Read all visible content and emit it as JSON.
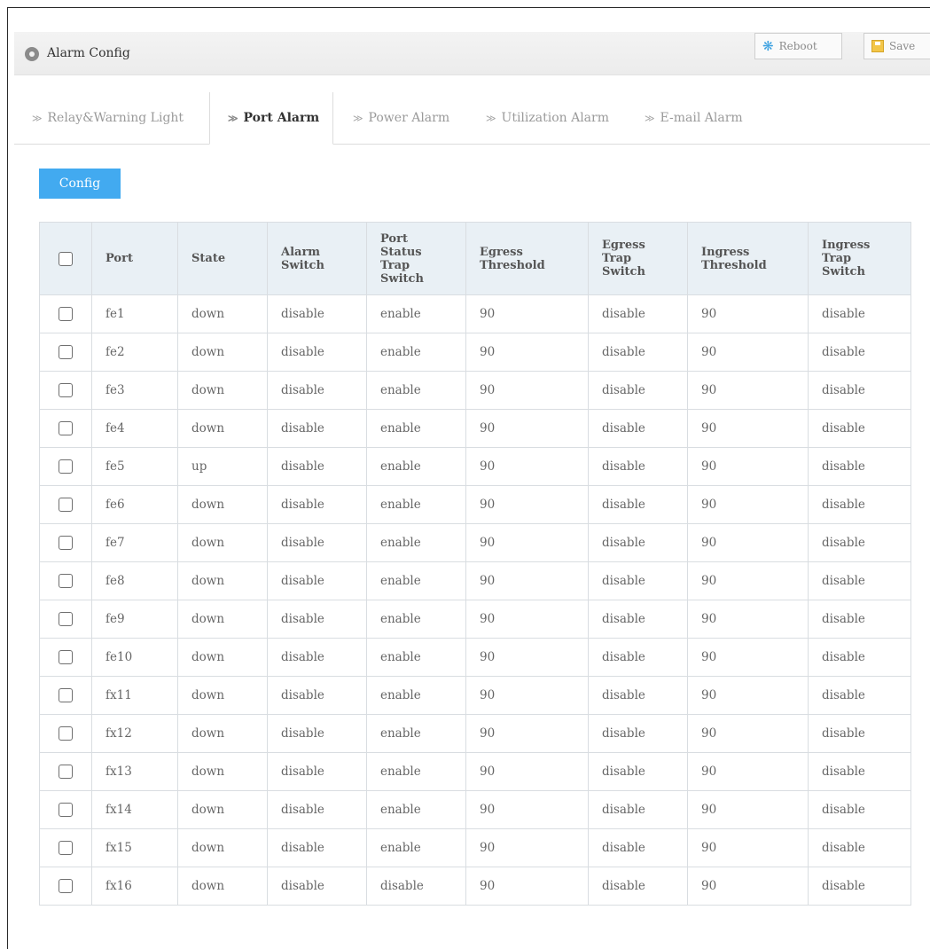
{
  "window": {
    "title": "Alarm Config",
    "reboot_label": "Reboot",
    "save_label": "Save"
  },
  "tabs": [
    {
      "label": "Relay&Warning Light",
      "active": false
    },
    {
      "label": "Port Alarm",
      "active": true
    },
    {
      "label": "Power Alarm",
      "active": false
    },
    {
      "label": "Utilization Alarm",
      "active": false
    },
    {
      "label": "E-mail Alarm",
      "active": false
    }
  ],
  "config_button": "Config",
  "table": {
    "headers": [
      "Port",
      "State",
      "Alarm Switch",
      "Port Status Trap Switch",
      "Egress Threshold",
      "Egress Trap Switch",
      "Ingress Threshold",
      "Ingress Trap Switch"
    ],
    "rows": [
      [
        "fe1",
        "down",
        "disable",
        "enable",
        "90",
        "disable",
        "90",
        "disable"
      ],
      [
        "fe2",
        "down",
        "disable",
        "enable",
        "90",
        "disable",
        "90",
        "disable"
      ],
      [
        "fe3",
        "down",
        "disable",
        "enable",
        "90",
        "disable",
        "90",
        "disable"
      ],
      [
        "fe4",
        "down",
        "disable",
        "enable",
        "90",
        "disable",
        "90",
        "disable"
      ],
      [
        "fe5",
        "up",
        "disable",
        "enable",
        "90",
        "disable",
        "90",
        "disable"
      ],
      [
        "fe6",
        "down",
        "disable",
        "enable",
        "90",
        "disable",
        "90",
        "disable"
      ],
      [
        "fe7",
        "down",
        "disable",
        "enable",
        "90",
        "disable",
        "90",
        "disable"
      ],
      [
        "fe8",
        "down",
        "disable",
        "enable",
        "90",
        "disable",
        "90",
        "disable"
      ],
      [
        "fe9",
        "down",
        "disable",
        "enable",
        "90",
        "disable",
        "90",
        "disable"
      ],
      [
        "fe10",
        "down",
        "disable",
        "enable",
        "90",
        "disable",
        "90",
        "disable"
      ],
      [
        "fx11",
        "down",
        "disable",
        "enable",
        "90",
        "disable",
        "90",
        "disable"
      ],
      [
        "fx12",
        "down",
        "disable",
        "enable",
        "90",
        "disable",
        "90",
        "disable"
      ],
      [
        "fx13",
        "down",
        "disable",
        "enable",
        "90",
        "disable",
        "90",
        "disable"
      ],
      [
        "fx14",
        "down",
        "disable",
        "enable",
        "90",
        "disable",
        "90",
        "disable"
      ],
      [
        "fx15",
        "down",
        "disable",
        "enable",
        "90",
        "disable",
        "90",
        "disable"
      ],
      [
        "fx16",
        "down",
        "disable",
        "disable",
        "90",
        "disable",
        "90",
        "disable"
      ]
    ]
  },
  "icons": {
    "title": "location-pin-icon",
    "reboot": "reboot-icon",
    "save": "save-icon",
    "tab_chevron": "chevron-right-icon"
  },
  "colors": {
    "accent": "#42aaf0",
    "header_bg": "#e9f0f5",
    "titlebar_bg": "#efefef"
  }
}
